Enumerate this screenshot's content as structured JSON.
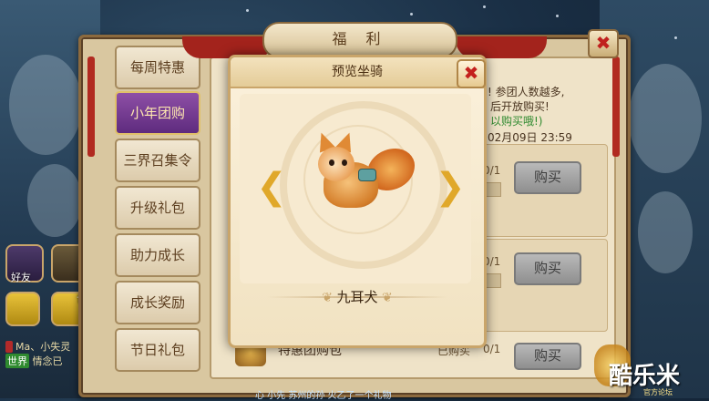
{
  "window": {
    "title": "福 利",
    "close_symbol": "✖"
  },
  "tabs": [
    {
      "label": "每周特惠",
      "active": false
    },
    {
      "label": "小年团购",
      "active": true
    },
    {
      "label": "三界召集令",
      "active": false
    },
    {
      "label": "升级礼包",
      "active": false
    },
    {
      "label": "助力成长",
      "active": false
    },
    {
      "label": "成长奖励",
      "active": false
    },
    {
      "label": "节日礼包",
      "active": false
    }
  ],
  "panel": {
    "info_line1": "! 参团人数越多,",
    "info_line2": "后开放购买!",
    "info_line3": "以购买哦!)",
    "deadline": "02月09日 23:59",
    "rows": [
      {
        "count": "0/1",
        "button": "购买"
      },
      {
        "count": "0/1",
        "button": "购买"
      },
      {
        "name": "特惠团购包",
        "status": "已购买",
        "count": "0/1",
        "button": "购买"
      }
    ]
  },
  "modal": {
    "title": "预览坐骑",
    "close_symbol": "✖",
    "mount_name": "九耳犬",
    "prev_icon": "left-curl-arrow-icon",
    "next_icon": "right-curl-arrow-icon"
  },
  "sidebar": {
    "friends_label": "好友",
    "world_label": "世"
  },
  "chat": {
    "lines": [
      {
        "tag": "",
        "text": "Ma、小失灵"
      },
      {
        "tag": "世界",
        "text": "情念已"
      },
      {
        "tag": "",
        "text": "心 小先 苏州的孙 火乙了一个礼物"
      }
    ]
  },
  "watermark": {
    "brand": "酷乐米",
    "sub": "官方论坛"
  },
  "colors": {
    "active_tab": "#6a358c",
    "close_red": "#c4201d",
    "frame_border": "#8c6a3e",
    "green_text": "#2f8a2f"
  }
}
